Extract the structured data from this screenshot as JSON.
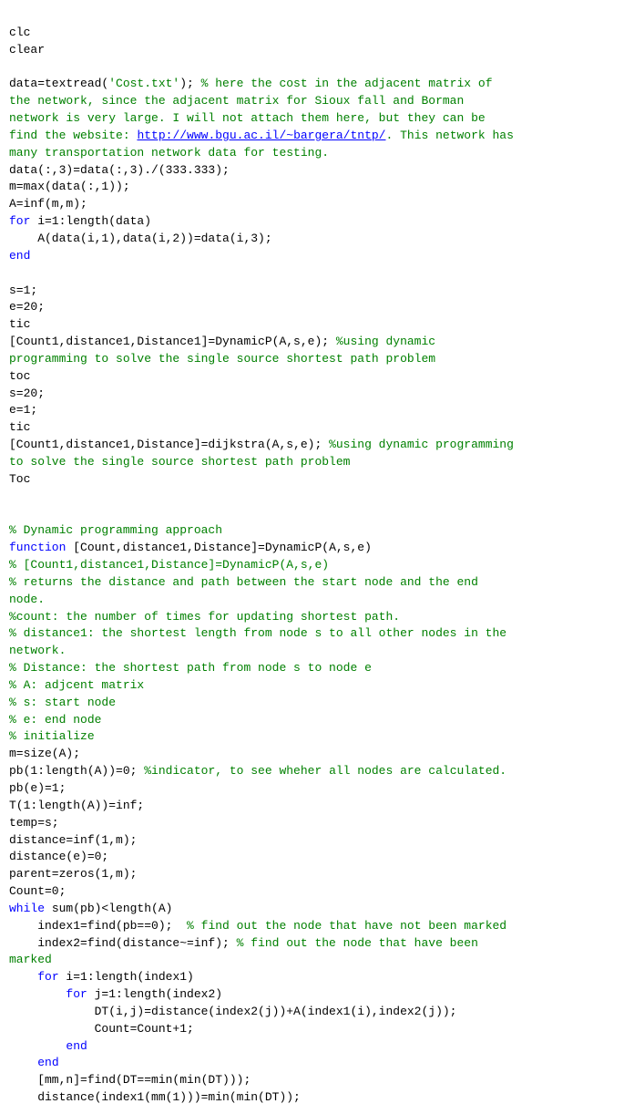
{
  "code": {
    "lines": []
  },
  "colors": {
    "black": "#000000",
    "green": "#008000",
    "blue": "#0000ff"
  }
}
